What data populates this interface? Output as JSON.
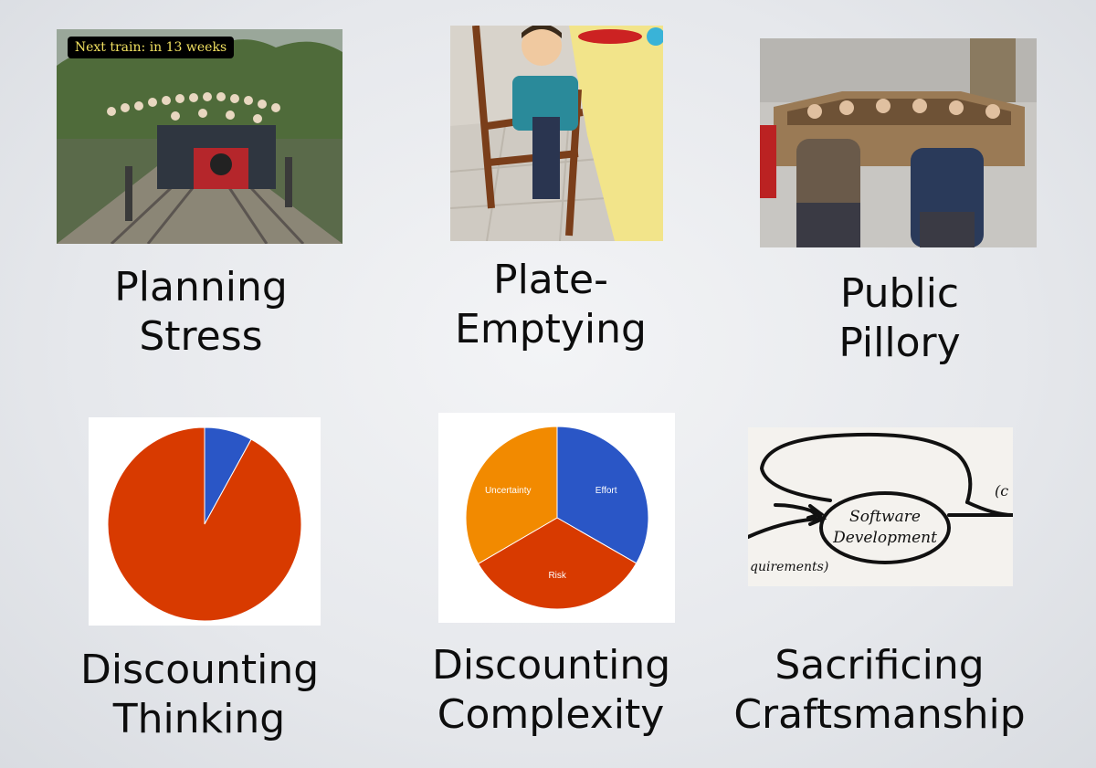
{
  "slide": {
    "tiles": [
      {
        "caption_lines": [
          "Planning",
          "Stress"
        ],
        "image_overlay_text": "Next train: in 13 weeks",
        "image": "overcrowded-train-photo"
      },
      {
        "caption_lines": [
          "Plate-",
          "Emptying"
        ],
        "image": "child-at-table-photo"
      },
      {
        "caption_lines": [
          "Public",
          "Pillory"
        ],
        "image": "pillory-photo"
      },
      {
        "caption_lines": [
          "Discounting",
          "Thinking"
        ],
        "image": "pie-chart-two-slice"
      },
      {
        "caption_lines": [
          "Discounting",
          "Complexity"
        ],
        "image": "pie-chart-three-slice"
      },
      {
        "caption_lines": [
          "Sacrificing",
          "Craftsmanship"
        ],
        "image": "software-development-sketch"
      }
    ]
  },
  "chart_data": [
    {
      "type": "pie",
      "categories": [
        "",
        ""
      ],
      "values": [
        8,
        92
      ],
      "colors": [
        "#2a56c6",
        "#d83a00"
      ],
      "title": "",
      "legend": "none"
    },
    {
      "type": "pie",
      "categories": [
        "Effort",
        "Risk",
        "Uncertainty"
      ],
      "values": [
        33.3,
        33.3,
        33.4
      ],
      "colors": [
        "#2a56c6",
        "#d83a00",
        "#f28a00"
      ],
      "title": "",
      "legend": "none"
    }
  ],
  "sketch": {
    "center_text_lines": [
      "Software",
      "Development"
    ],
    "left_text": "quirements)",
    "right_text": "(c"
  },
  "colors": {
    "background": "#e8eaed",
    "pie_blue": "#2a56c6",
    "pie_red": "#d83a00",
    "pie_orange": "#f28a00"
  }
}
